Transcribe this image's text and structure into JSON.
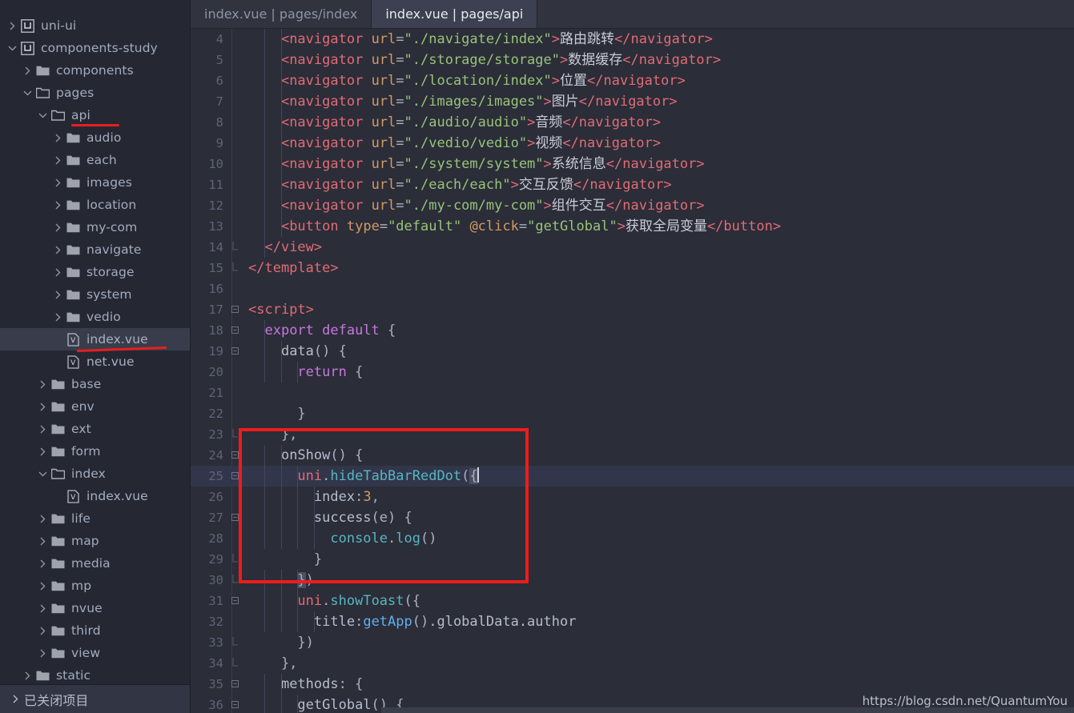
{
  "sidebar": {
    "tree": [
      {
        "label": "uni-ui",
        "icon": "project-icon",
        "indent": 0,
        "arrow": "right",
        "type": "project"
      },
      {
        "label": "components-study",
        "icon": "project-icon",
        "indent": 0,
        "arrow": "down",
        "type": "project"
      },
      {
        "label": "components",
        "icon": "folder-icon",
        "indent": 1,
        "arrow": "right",
        "type": "folder"
      },
      {
        "label": "pages",
        "icon": "folder-open-icon",
        "indent": 1,
        "arrow": "down",
        "type": "folder"
      },
      {
        "label": "api",
        "icon": "folder-open-icon",
        "indent": 2,
        "arrow": "down",
        "type": "folder",
        "underline": "straight"
      },
      {
        "label": "audio",
        "icon": "folder-icon",
        "indent": 3,
        "arrow": "right",
        "type": "folder"
      },
      {
        "label": "each",
        "icon": "folder-icon",
        "indent": 3,
        "arrow": "right",
        "type": "folder"
      },
      {
        "label": "images",
        "icon": "folder-icon",
        "indent": 3,
        "arrow": "right",
        "type": "folder"
      },
      {
        "label": "location",
        "icon": "folder-icon",
        "indent": 3,
        "arrow": "right",
        "type": "folder"
      },
      {
        "label": "my-com",
        "icon": "folder-icon",
        "indent": 3,
        "arrow": "right",
        "type": "folder"
      },
      {
        "label": "navigate",
        "icon": "folder-icon",
        "indent": 3,
        "arrow": "right",
        "type": "folder"
      },
      {
        "label": "storage",
        "icon": "folder-icon",
        "indent": 3,
        "arrow": "right",
        "type": "folder"
      },
      {
        "label": "system",
        "icon": "folder-icon",
        "indent": 3,
        "arrow": "right",
        "type": "folder"
      },
      {
        "label": "vedio",
        "icon": "folder-icon",
        "indent": 3,
        "arrow": "right",
        "type": "folder"
      },
      {
        "label": "index.vue",
        "icon": "vue-file-icon",
        "indent": 3,
        "arrow": "none",
        "type": "file",
        "selected": true,
        "underline": "slant"
      },
      {
        "label": "net.vue",
        "icon": "vue-file-icon",
        "indent": 3,
        "arrow": "none",
        "type": "file"
      },
      {
        "label": "base",
        "icon": "folder-icon",
        "indent": 2,
        "arrow": "right",
        "type": "folder"
      },
      {
        "label": "env",
        "icon": "folder-icon",
        "indent": 2,
        "arrow": "right",
        "type": "folder"
      },
      {
        "label": "ext",
        "icon": "folder-icon",
        "indent": 2,
        "arrow": "right",
        "type": "folder"
      },
      {
        "label": "form",
        "icon": "folder-icon",
        "indent": 2,
        "arrow": "right",
        "type": "folder"
      },
      {
        "label": "index",
        "icon": "folder-open-icon",
        "indent": 2,
        "arrow": "down",
        "type": "folder"
      },
      {
        "label": "index.vue",
        "icon": "vue-file-icon",
        "indent": 3,
        "arrow": "none",
        "type": "file"
      },
      {
        "label": "life",
        "icon": "folder-icon",
        "indent": 2,
        "arrow": "right",
        "type": "folder"
      },
      {
        "label": "map",
        "icon": "folder-icon",
        "indent": 2,
        "arrow": "right",
        "type": "folder"
      },
      {
        "label": "media",
        "icon": "folder-icon",
        "indent": 2,
        "arrow": "right",
        "type": "folder"
      },
      {
        "label": "mp",
        "icon": "folder-icon",
        "indent": 2,
        "arrow": "right",
        "type": "folder"
      },
      {
        "label": "nvue",
        "icon": "folder-icon",
        "indent": 2,
        "arrow": "right",
        "type": "folder"
      },
      {
        "label": "third",
        "icon": "folder-icon",
        "indent": 2,
        "arrow": "right",
        "type": "folder"
      },
      {
        "label": "view",
        "icon": "folder-icon",
        "indent": 2,
        "arrow": "right",
        "type": "folder"
      },
      {
        "label": "static",
        "icon": "folder-icon",
        "indent": 1,
        "arrow": "right",
        "type": "folder"
      }
    ],
    "closed_projects_label": "已关闭项目"
  },
  "tabs": [
    {
      "label": "index.vue | pages/index",
      "active": false
    },
    {
      "label": "index.vue | pages/api",
      "active": true
    }
  ],
  "editor": {
    "first_line": 4,
    "cursor_line": 25,
    "lines": [
      {
        "n": 4,
        "fold": "",
        "tokens": [
          {
            "t": "    ",
            "c": "t-plain"
          },
          {
            "t": "<navigator",
            "c": "t-tag"
          },
          {
            "t": " ",
            "c": "t-plain"
          },
          {
            "t": "url",
            "c": "t-attr"
          },
          {
            "t": "=",
            "c": "t-punc"
          },
          {
            "t": "\"./navigate/index\"",
            "c": "t-str"
          },
          {
            "t": ">",
            "c": "t-tag"
          },
          {
            "t": "路由跳转",
            "c": "t-txt"
          },
          {
            "t": "</navigator>",
            "c": "t-tag"
          }
        ]
      },
      {
        "n": 5,
        "fold": "",
        "tokens": [
          {
            "t": "    ",
            "c": "t-plain"
          },
          {
            "t": "<navigator",
            "c": "t-tag"
          },
          {
            "t": " ",
            "c": "t-plain"
          },
          {
            "t": "url",
            "c": "t-attr"
          },
          {
            "t": "=",
            "c": "t-punc"
          },
          {
            "t": "\"./storage/storage\"",
            "c": "t-str"
          },
          {
            "t": ">",
            "c": "t-tag"
          },
          {
            "t": "数据缓存",
            "c": "t-txt"
          },
          {
            "t": "</navigator>",
            "c": "t-tag"
          }
        ]
      },
      {
        "n": 6,
        "fold": "",
        "tokens": [
          {
            "t": "    ",
            "c": "t-plain"
          },
          {
            "t": "<navigator",
            "c": "t-tag"
          },
          {
            "t": " ",
            "c": "t-plain"
          },
          {
            "t": "url",
            "c": "t-attr"
          },
          {
            "t": "=",
            "c": "t-punc"
          },
          {
            "t": "\"./location/index\"",
            "c": "t-str"
          },
          {
            "t": ">",
            "c": "t-tag"
          },
          {
            "t": "位置",
            "c": "t-txt"
          },
          {
            "t": "</navigator>",
            "c": "t-tag"
          }
        ]
      },
      {
        "n": 7,
        "fold": "",
        "tokens": [
          {
            "t": "    ",
            "c": "t-plain"
          },
          {
            "t": "<navigator",
            "c": "t-tag"
          },
          {
            "t": " ",
            "c": "t-plain"
          },
          {
            "t": "url",
            "c": "t-attr"
          },
          {
            "t": "=",
            "c": "t-punc"
          },
          {
            "t": "\"./images/images\"",
            "c": "t-str"
          },
          {
            "t": ">",
            "c": "t-tag"
          },
          {
            "t": "图片",
            "c": "t-txt"
          },
          {
            "t": "</navigator>",
            "c": "t-tag"
          }
        ]
      },
      {
        "n": 8,
        "fold": "",
        "tokens": [
          {
            "t": "    ",
            "c": "t-plain"
          },
          {
            "t": "<navigator",
            "c": "t-tag"
          },
          {
            "t": " ",
            "c": "t-plain"
          },
          {
            "t": "url",
            "c": "t-attr"
          },
          {
            "t": "=",
            "c": "t-punc"
          },
          {
            "t": "\"./audio/audio\"",
            "c": "t-str"
          },
          {
            "t": ">",
            "c": "t-tag"
          },
          {
            "t": "音频",
            "c": "t-txt"
          },
          {
            "t": "</navigator>",
            "c": "t-tag"
          }
        ]
      },
      {
        "n": 9,
        "fold": "",
        "tokens": [
          {
            "t": "    ",
            "c": "t-plain"
          },
          {
            "t": "<navigator",
            "c": "t-tag"
          },
          {
            "t": " ",
            "c": "t-plain"
          },
          {
            "t": "url",
            "c": "t-attr"
          },
          {
            "t": "=",
            "c": "t-punc"
          },
          {
            "t": "\"./vedio/vedio\"",
            "c": "t-str"
          },
          {
            "t": ">",
            "c": "t-tag"
          },
          {
            "t": "视频",
            "c": "t-txt"
          },
          {
            "t": "</navigator>",
            "c": "t-tag"
          }
        ]
      },
      {
        "n": 10,
        "fold": "",
        "tokens": [
          {
            "t": "    ",
            "c": "t-plain"
          },
          {
            "t": "<navigator",
            "c": "t-tag"
          },
          {
            "t": " ",
            "c": "t-plain"
          },
          {
            "t": "url",
            "c": "t-attr"
          },
          {
            "t": "=",
            "c": "t-punc"
          },
          {
            "t": "\"./system/system\"",
            "c": "t-str"
          },
          {
            "t": ">",
            "c": "t-tag"
          },
          {
            "t": "系统信息",
            "c": "t-txt"
          },
          {
            "t": "</navigator>",
            "c": "t-tag"
          }
        ]
      },
      {
        "n": 11,
        "fold": "",
        "tokens": [
          {
            "t": "    ",
            "c": "t-plain"
          },
          {
            "t": "<navigator",
            "c": "t-tag"
          },
          {
            "t": " ",
            "c": "t-plain"
          },
          {
            "t": "url",
            "c": "t-attr"
          },
          {
            "t": "=",
            "c": "t-punc"
          },
          {
            "t": "\"./each/each\"",
            "c": "t-str"
          },
          {
            "t": ">",
            "c": "t-tag"
          },
          {
            "t": "交互反馈",
            "c": "t-txt"
          },
          {
            "t": "</navigator>",
            "c": "t-tag"
          }
        ]
      },
      {
        "n": 12,
        "fold": "",
        "tokens": [
          {
            "t": "    ",
            "c": "t-plain"
          },
          {
            "t": "<navigator",
            "c": "t-tag"
          },
          {
            "t": " ",
            "c": "t-plain"
          },
          {
            "t": "url",
            "c": "t-attr"
          },
          {
            "t": "=",
            "c": "t-punc"
          },
          {
            "t": "\"./my-com/my-com\"",
            "c": "t-str"
          },
          {
            "t": ">",
            "c": "t-tag"
          },
          {
            "t": "组件交互",
            "c": "t-txt"
          },
          {
            "t": "</navigator>",
            "c": "t-tag"
          }
        ]
      },
      {
        "n": 13,
        "fold": "",
        "tokens": [
          {
            "t": "    ",
            "c": "t-plain"
          },
          {
            "t": "<button",
            "c": "t-tag"
          },
          {
            "t": " ",
            "c": "t-plain"
          },
          {
            "t": "type",
            "c": "t-attr"
          },
          {
            "t": "=",
            "c": "t-punc"
          },
          {
            "t": "\"default\"",
            "c": "t-str"
          },
          {
            "t": " ",
            "c": "t-plain"
          },
          {
            "t": "@click",
            "c": "t-attr"
          },
          {
            "t": "=",
            "c": "t-punc"
          },
          {
            "t": "\"getGlobal\"",
            "c": "t-str"
          },
          {
            "t": ">",
            "c": "t-tag"
          },
          {
            "t": "获取全局变量",
            "c": "t-txt"
          },
          {
            "t": "</button>",
            "c": "t-tag"
          }
        ]
      },
      {
        "n": 14,
        "fold": "-",
        "tokens": [
          {
            "t": "  ",
            "c": "t-plain"
          },
          {
            "t": "</view>",
            "c": "t-tag"
          }
        ]
      },
      {
        "n": 15,
        "fold": "-",
        "tokens": [
          {
            "t": "</template>",
            "c": "t-tag"
          }
        ]
      },
      {
        "n": 16,
        "fold": "",
        "tokens": []
      },
      {
        "n": 17,
        "fold": "+",
        "tokens": [
          {
            "t": "<script>",
            "c": "t-tag"
          }
        ]
      },
      {
        "n": 18,
        "fold": "+",
        "tokens": [
          {
            "t": "  ",
            "c": "t-plain"
          },
          {
            "t": "export default",
            "c": "t-kw"
          },
          {
            "t": " {",
            "c": "t-punc"
          }
        ]
      },
      {
        "n": 19,
        "fold": "+",
        "tokens": [
          {
            "t": "    ",
            "c": "t-plain"
          },
          {
            "t": "data",
            "c": "t-plain"
          },
          {
            "t": "() {",
            "c": "t-punc"
          }
        ]
      },
      {
        "n": 20,
        "fold": "",
        "tokens": [
          {
            "t": "      ",
            "c": "t-plain"
          },
          {
            "t": "return",
            "c": "t-kw"
          },
          {
            "t": " {",
            "c": "t-punc"
          }
        ]
      },
      {
        "n": 21,
        "fold": "",
        "tokens": []
      },
      {
        "n": 22,
        "fold": "",
        "tokens": [
          {
            "t": "      }",
            "c": "t-punc"
          }
        ]
      },
      {
        "n": 23,
        "fold": "-",
        "tokens": [
          {
            "t": "    },",
            "c": "t-punc"
          }
        ]
      },
      {
        "n": 24,
        "fold": "+",
        "tokens": [
          {
            "t": "    ",
            "c": "t-plain"
          },
          {
            "t": "onShow",
            "c": "t-plain"
          },
          {
            "t": "() {",
            "c": "t-punc"
          }
        ]
      },
      {
        "n": 25,
        "fold": "+",
        "hl": true,
        "caret_after": 7,
        "tokens": [
          {
            "t": "      ",
            "c": "t-plain"
          },
          {
            "t": "uni",
            "c": "t-obj"
          },
          {
            "t": ".",
            "c": "t-punc"
          },
          {
            "t": "hideTabBarRedDot",
            "c": "t-prop"
          },
          {
            "t": "(",
            "c": "t-punc"
          },
          {
            "t": "{",
            "c": "brmatch t-punc"
          }
        ]
      },
      {
        "n": 26,
        "fold": "",
        "tokens": [
          {
            "t": "        ",
            "c": "t-plain"
          },
          {
            "t": "index",
            "c": "t-plain"
          },
          {
            "t": ":",
            "c": "t-punc"
          },
          {
            "t": "3",
            "c": "t-num"
          },
          {
            "t": ",",
            "c": "t-punc"
          }
        ]
      },
      {
        "n": 27,
        "fold": "+",
        "tokens": [
          {
            "t": "        ",
            "c": "t-plain"
          },
          {
            "t": "success",
            "c": "t-plain"
          },
          {
            "t": "(e) {",
            "c": "t-punc"
          }
        ]
      },
      {
        "n": 28,
        "fold": "",
        "tokens": [
          {
            "t": "          ",
            "c": "t-plain"
          },
          {
            "t": "console",
            "c": "t-prop"
          },
          {
            "t": ".",
            "c": "t-punc"
          },
          {
            "t": "log",
            "c": "t-prop"
          },
          {
            "t": "()",
            "c": "t-punc"
          }
        ]
      },
      {
        "n": 29,
        "fold": "-",
        "tokens": [
          {
            "t": "        }",
            "c": "t-punc"
          }
        ]
      },
      {
        "n": 30,
        "fold": "-",
        "tokens": [
          {
            "t": "      ",
            "c": "t-plain"
          },
          {
            "t": "}",
            "c": "brmatch t-punc"
          },
          {
            "t": ")",
            "c": "t-punc"
          }
        ]
      },
      {
        "n": 31,
        "fold": "+",
        "tokens": [
          {
            "t": "      ",
            "c": "t-plain"
          },
          {
            "t": "uni",
            "c": "t-obj"
          },
          {
            "t": ".",
            "c": "t-punc"
          },
          {
            "t": "showToast",
            "c": "t-prop"
          },
          {
            "t": "({",
            "c": "t-punc"
          }
        ]
      },
      {
        "n": 32,
        "fold": "",
        "tokens": [
          {
            "t": "        ",
            "c": "t-plain"
          },
          {
            "t": "title",
            "c": "t-plain"
          },
          {
            "t": ":",
            "c": "t-punc"
          },
          {
            "t": "getApp",
            "c": "t-fn"
          },
          {
            "t": "()",
            "c": "t-punc"
          },
          {
            "t": ".globalData.author",
            "c": "t-plain"
          }
        ]
      },
      {
        "n": 33,
        "fold": "-",
        "tokens": [
          {
            "t": "      })",
            "c": "t-punc"
          }
        ]
      },
      {
        "n": 34,
        "fold": "-",
        "tokens": [
          {
            "t": "    },",
            "c": "t-punc"
          }
        ]
      },
      {
        "n": 35,
        "fold": "+",
        "tokens": [
          {
            "t": "    ",
            "c": "t-plain"
          },
          {
            "t": "methods",
            "c": "t-plain"
          },
          {
            "t": ": {",
            "c": "t-punc"
          }
        ]
      },
      {
        "n": 36,
        "fold": "+",
        "tokens": [
          {
            "t": "      ",
            "c": "t-plain"
          },
          {
            "t": "getGlobal",
            "c": "t-plain"
          },
          {
            "t": "() {",
            "c": "t-punc"
          }
        ]
      }
    ]
  },
  "annotations": {
    "redbox_label": "highlighted-code-region",
    "red_color": "#ee1c1c"
  },
  "watermark": "https://blog.csdn.net/QuantumYou"
}
